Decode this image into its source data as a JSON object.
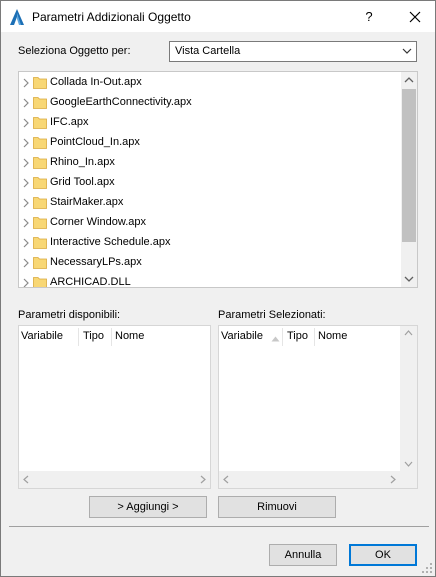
{
  "window": {
    "title": "Parametri Addizionali Oggetto",
    "help_label": "?"
  },
  "selector": {
    "label": "Seleziona Oggetto per:",
    "value": "Vista Cartella"
  },
  "tree": {
    "items": [
      {
        "label": "Collada In-Out.apx"
      },
      {
        "label": "GoogleEarthConnectivity.apx"
      },
      {
        "label": "IFC.apx"
      },
      {
        "label": "PointCloud_In.apx"
      },
      {
        "label": "Rhino_In.apx"
      },
      {
        "label": "Grid Tool.apx"
      },
      {
        "label": "StairMaker.apx"
      },
      {
        "label": "Corner Window.apx"
      },
      {
        "label": "Interactive Schedule.apx"
      },
      {
        "label": "NecessaryLPs.apx"
      },
      {
        "label": "ARCHICAD.DLL"
      }
    ]
  },
  "available": {
    "title": "Parametri disponibili:",
    "columns": [
      "Variabile",
      "Tipo",
      "Nome"
    ]
  },
  "selected": {
    "title": "Parametri Selezionati:",
    "columns": [
      "Variabile",
      "Tipo",
      "Nome"
    ]
  },
  "actions": {
    "add_label": "> Aggiungi >",
    "remove_label": "Rimuovi"
  },
  "footer": {
    "cancel_label": "Annulla",
    "ok_label": "OK"
  },
  "colors": {
    "folder": "#f8d775",
    "accent": "#0078d7",
    "app_icon": "#1c6fb5"
  }
}
